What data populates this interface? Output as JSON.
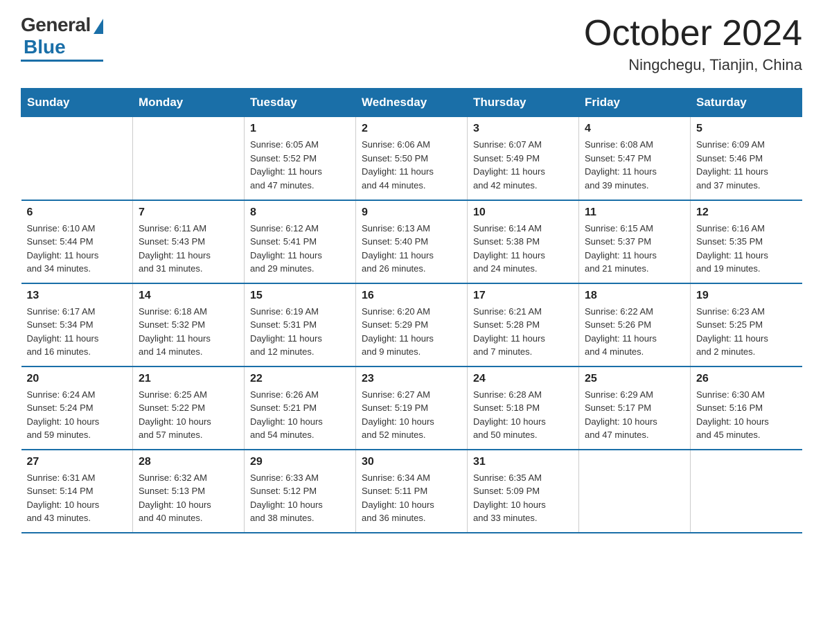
{
  "logo": {
    "general": "General",
    "blue": "Blue"
  },
  "title": "October 2024",
  "location": "Ningchegu, Tianjin, China",
  "days_of_week": [
    "Sunday",
    "Monday",
    "Tuesday",
    "Wednesday",
    "Thursday",
    "Friday",
    "Saturday"
  ],
  "weeks": [
    [
      {
        "day": "",
        "info": ""
      },
      {
        "day": "",
        "info": ""
      },
      {
        "day": "1",
        "info": "Sunrise: 6:05 AM\nSunset: 5:52 PM\nDaylight: 11 hours\nand 47 minutes."
      },
      {
        "day": "2",
        "info": "Sunrise: 6:06 AM\nSunset: 5:50 PM\nDaylight: 11 hours\nand 44 minutes."
      },
      {
        "day": "3",
        "info": "Sunrise: 6:07 AM\nSunset: 5:49 PM\nDaylight: 11 hours\nand 42 minutes."
      },
      {
        "day": "4",
        "info": "Sunrise: 6:08 AM\nSunset: 5:47 PM\nDaylight: 11 hours\nand 39 minutes."
      },
      {
        "day": "5",
        "info": "Sunrise: 6:09 AM\nSunset: 5:46 PM\nDaylight: 11 hours\nand 37 minutes."
      }
    ],
    [
      {
        "day": "6",
        "info": "Sunrise: 6:10 AM\nSunset: 5:44 PM\nDaylight: 11 hours\nand 34 minutes."
      },
      {
        "day": "7",
        "info": "Sunrise: 6:11 AM\nSunset: 5:43 PM\nDaylight: 11 hours\nand 31 minutes."
      },
      {
        "day": "8",
        "info": "Sunrise: 6:12 AM\nSunset: 5:41 PM\nDaylight: 11 hours\nand 29 minutes."
      },
      {
        "day": "9",
        "info": "Sunrise: 6:13 AM\nSunset: 5:40 PM\nDaylight: 11 hours\nand 26 minutes."
      },
      {
        "day": "10",
        "info": "Sunrise: 6:14 AM\nSunset: 5:38 PM\nDaylight: 11 hours\nand 24 minutes."
      },
      {
        "day": "11",
        "info": "Sunrise: 6:15 AM\nSunset: 5:37 PM\nDaylight: 11 hours\nand 21 minutes."
      },
      {
        "day": "12",
        "info": "Sunrise: 6:16 AM\nSunset: 5:35 PM\nDaylight: 11 hours\nand 19 minutes."
      }
    ],
    [
      {
        "day": "13",
        "info": "Sunrise: 6:17 AM\nSunset: 5:34 PM\nDaylight: 11 hours\nand 16 minutes."
      },
      {
        "day": "14",
        "info": "Sunrise: 6:18 AM\nSunset: 5:32 PM\nDaylight: 11 hours\nand 14 minutes."
      },
      {
        "day": "15",
        "info": "Sunrise: 6:19 AM\nSunset: 5:31 PM\nDaylight: 11 hours\nand 12 minutes."
      },
      {
        "day": "16",
        "info": "Sunrise: 6:20 AM\nSunset: 5:29 PM\nDaylight: 11 hours\nand 9 minutes."
      },
      {
        "day": "17",
        "info": "Sunrise: 6:21 AM\nSunset: 5:28 PM\nDaylight: 11 hours\nand 7 minutes."
      },
      {
        "day": "18",
        "info": "Sunrise: 6:22 AM\nSunset: 5:26 PM\nDaylight: 11 hours\nand 4 minutes."
      },
      {
        "day": "19",
        "info": "Sunrise: 6:23 AM\nSunset: 5:25 PM\nDaylight: 11 hours\nand 2 minutes."
      }
    ],
    [
      {
        "day": "20",
        "info": "Sunrise: 6:24 AM\nSunset: 5:24 PM\nDaylight: 10 hours\nand 59 minutes."
      },
      {
        "day": "21",
        "info": "Sunrise: 6:25 AM\nSunset: 5:22 PM\nDaylight: 10 hours\nand 57 minutes."
      },
      {
        "day": "22",
        "info": "Sunrise: 6:26 AM\nSunset: 5:21 PM\nDaylight: 10 hours\nand 54 minutes."
      },
      {
        "day": "23",
        "info": "Sunrise: 6:27 AM\nSunset: 5:19 PM\nDaylight: 10 hours\nand 52 minutes."
      },
      {
        "day": "24",
        "info": "Sunrise: 6:28 AM\nSunset: 5:18 PM\nDaylight: 10 hours\nand 50 minutes."
      },
      {
        "day": "25",
        "info": "Sunrise: 6:29 AM\nSunset: 5:17 PM\nDaylight: 10 hours\nand 47 minutes."
      },
      {
        "day": "26",
        "info": "Sunrise: 6:30 AM\nSunset: 5:16 PM\nDaylight: 10 hours\nand 45 minutes."
      }
    ],
    [
      {
        "day": "27",
        "info": "Sunrise: 6:31 AM\nSunset: 5:14 PM\nDaylight: 10 hours\nand 43 minutes."
      },
      {
        "day": "28",
        "info": "Sunrise: 6:32 AM\nSunset: 5:13 PM\nDaylight: 10 hours\nand 40 minutes."
      },
      {
        "day": "29",
        "info": "Sunrise: 6:33 AM\nSunset: 5:12 PM\nDaylight: 10 hours\nand 38 minutes."
      },
      {
        "day": "30",
        "info": "Sunrise: 6:34 AM\nSunset: 5:11 PM\nDaylight: 10 hours\nand 36 minutes."
      },
      {
        "day": "31",
        "info": "Sunrise: 6:35 AM\nSunset: 5:09 PM\nDaylight: 10 hours\nand 33 minutes."
      },
      {
        "day": "",
        "info": ""
      },
      {
        "day": "",
        "info": ""
      }
    ]
  ]
}
